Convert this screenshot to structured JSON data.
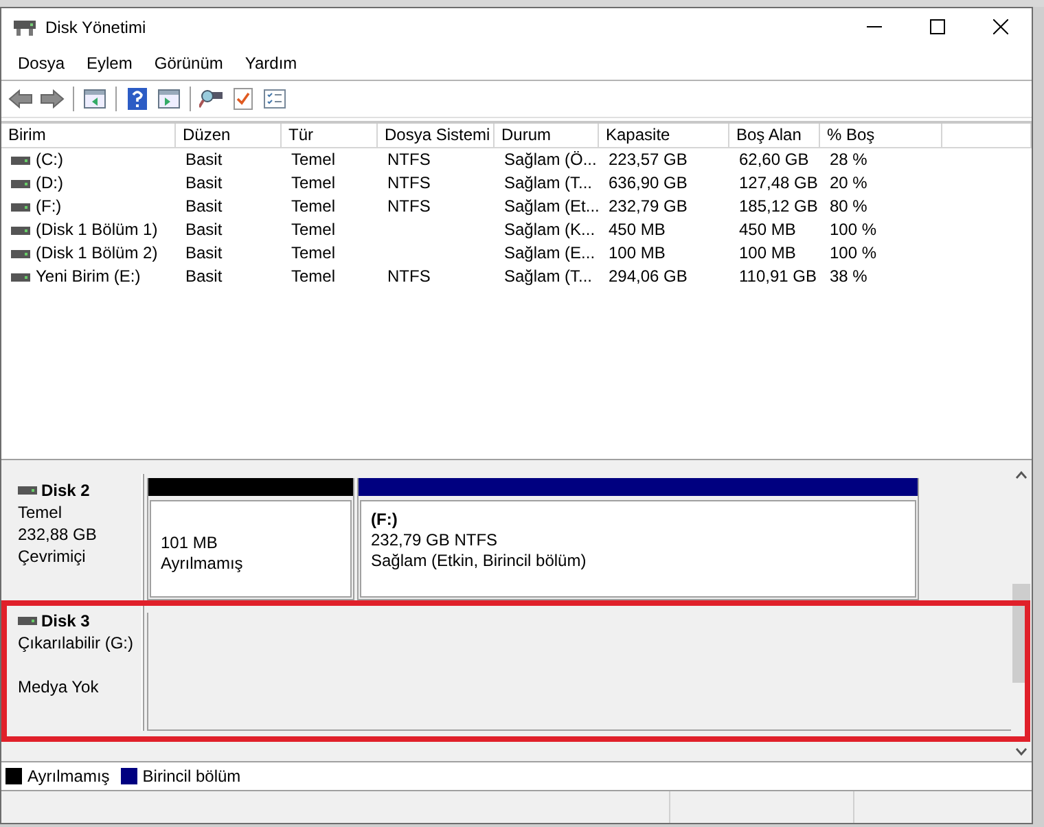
{
  "window": {
    "title": "Disk Yönetimi"
  },
  "menu": [
    "Dosya",
    "Eylem",
    "Görünüm",
    "Yardım"
  ],
  "toolbar": [
    {
      "kind": "back"
    },
    {
      "kind": "forward"
    },
    {
      "kind": "sep"
    },
    {
      "kind": "panel"
    },
    {
      "kind": "sep"
    },
    {
      "kind": "help"
    },
    {
      "kind": "panel2"
    },
    {
      "kind": "sep"
    },
    {
      "kind": "scan"
    },
    {
      "kind": "doc"
    },
    {
      "kind": "list"
    }
  ],
  "table": {
    "columns": [
      "Birim",
      "Düzen",
      "Tür",
      "Dosya Sistemi",
      "Durum",
      "Kapasite",
      "Boş Alan",
      "% Boş"
    ],
    "rows": [
      [
        "(C:)",
        "Basit",
        "Temel",
        "NTFS",
        "Sağlam (Ö...",
        "223,57 GB",
        "62,60 GB",
        "28 %"
      ],
      [
        "(D:)",
        "Basit",
        "Temel",
        "NTFS",
        "Sağlam (T...",
        "636,90 GB",
        "127,48 GB",
        "20 %"
      ],
      [
        "(F:)",
        "Basit",
        "Temel",
        "NTFS",
        "Sağlam (Et...",
        "232,79 GB",
        "185,12 GB",
        "80 %"
      ],
      [
        "(Disk 1 Bölüm 1)",
        "Basit",
        "Temel",
        null,
        "Sağlam (K...",
        "450 MB",
        "450 MB",
        "100 %"
      ],
      [
        "(Disk 1 Bölüm 2)",
        "Basit",
        "Temel",
        null,
        "Sağlam (E...",
        "100 MB",
        "100 MB",
        "100 %"
      ],
      [
        "Yeni Birim (E:)",
        "Basit",
        "Temel",
        "NTFS",
        "Sağlam (T...",
        "294,06 GB",
        "110,91 GB",
        "38 %"
      ]
    ]
  },
  "disks": [
    {
      "name": "Disk 2",
      "type": "Temel",
      "capacity": "232,88 GB",
      "state": "Çevrimiçi",
      "highlighted": false,
      "partitions": [
        {
          "kind": "unallocated",
          "size": "101 MB",
          "status": "Ayrılmamış"
        },
        {
          "kind": "primary",
          "name": "(F:)",
          "size": "232,79 GB NTFS",
          "status": "Sağlam (Etkin, Birincil bölüm)"
        }
      ]
    },
    {
      "name": "Disk 3",
      "type": "Çıkarılabilir (G:)",
      "state": "Medya Yok",
      "highlighted": true
    }
  ],
  "legend": [
    {
      "label": "Ayrılmamış",
      "color": "#000000"
    },
    {
      "label": "Birincil bölüm",
      "color": "#000080"
    }
  ]
}
